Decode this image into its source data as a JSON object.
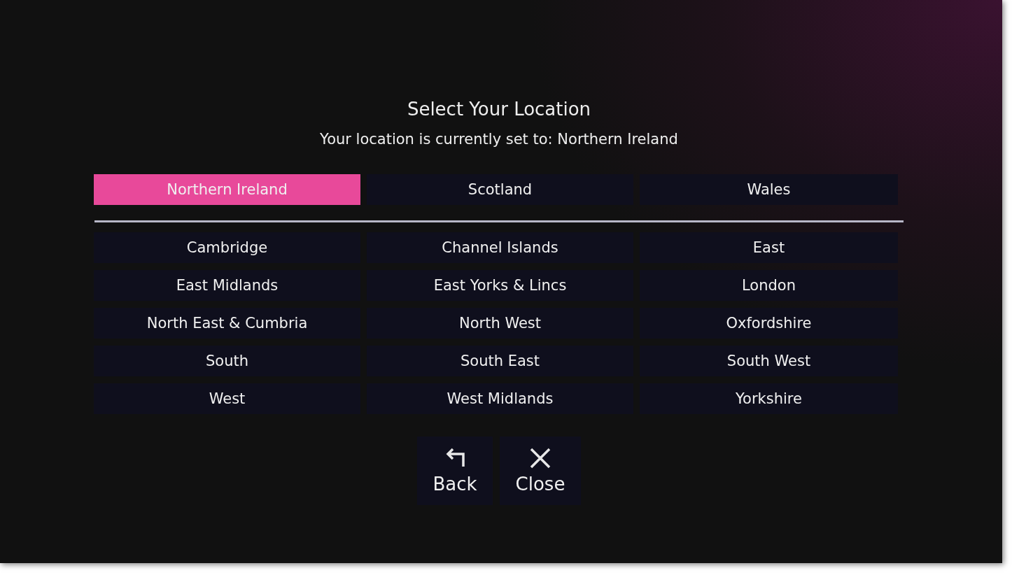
{
  "title": "Select Your Location",
  "subtitle": "Your location is currently set to: Northern Ireland",
  "nations": [
    {
      "label": "Northern Ireland",
      "selected": true
    },
    {
      "label": "Scotland",
      "selected": false
    },
    {
      "label": "Wales",
      "selected": false
    }
  ],
  "regions": [
    {
      "label": "Cambridge",
      "selected": false
    },
    {
      "label": "Channel Islands",
      "selected": false
    },
    {
      "label": "East",
      "selected": false
    },
    {
      "label": "East Midlands",
      "selected": false
    },
    {
      "label": "East Yorks & Lincs",
      "selected": false
    },
    {
      "label": "London",
      "selected": false
    },
    {
      "label": "North East & Cumbria",
      "selected": false
    },
    {
      "label": "North West",
      "selected": false
    },
    {
      "label": "Oxfordshire",
      "selected": false
    },
    {
      "label": "South",
      "selected": false
    },
    {
      "label": "South East",
      "selected": false
    },
    {
      "label": "South West",
      "selected": false
    },
    {
      "label": "West",
      "selected": false
    },
    {
      "label": "West Midlands",
      "selected": false
    },
    {
      "label": "Yorkshire",
      "selected": false
    }
  ],
  "buttons": [
    {
      "kind": "back",
      "label": "Back"
    },
    {
      "kind": "close",
      "label": "Close"
    }
  ]
}
